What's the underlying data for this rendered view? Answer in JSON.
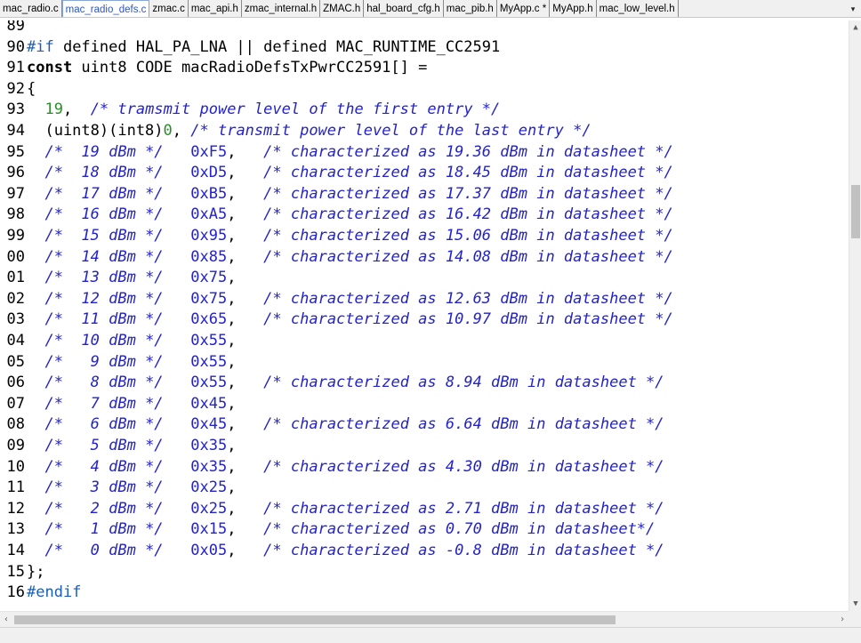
{
  "tabs": [
    {
      "label": "mac_radio.c",
      "active": false
    },
    {
      "label": "mac_radio_defs.c",
      "active": true
    },
    {
      "label": "zmac.c",
      "active": false
    },
    {
      "label": "mac_api.h",
      "active": false
    },
    {
      "label": "zmac_internal.h",
      "active": false
    },
    {
      "label": "ZMAC.h",
      "active": false
    },
    {
      "label": "hal_board_cfg.h",
      "active": false
    },
    {
      "label": "mac_pib.h",
      "active": false
    },
    {
      "label": "MyApp.c *",
      "active": false
    },
    {
      "label": "MyApp.h",
      "active": false
    },
    {
      "label": "mac_low_level.h",
      "active": false
    }
  ],
  "tab_overflow_icon": "chevron-down-icon",
  "colors": {
    "preprocessor": "#1a5fb4",
    "comment": "#2323c8",
    "number": "#2e8b2e",
    "active_tab_text": "#2b56c6"
  },
  "editor": {
    "lines": [
      {
        "num": "89",
        "tokens": []
      },
      {
        "num": "90",
        "tokens": [
          {
            "t": "pp",
            "v": "#if"
          },
          {
            "t": "plain",
            "v": " defined HAL_PA_LNA || defined MAC_RUNTIME_CC2591"
          }
        ]
      },
      {
        "num": "91",
        "tokens": [
          {
            "t": "kw",
            "v": "const"
          },
          {
            "t": "plain",
            "v": " uint8 CODE macRadioDefsTxPwrCC2591[] ="
          }
        ]
      },
      {
        "num": "92",
        "tokens": [
          {
            "t": "punc",
            "v": "{"
          }
        ]
      },
      {
        "num": "93",
        "tokens": [
          {
            "t": "plain",
            "v": "  "
          },
          {
            "t": "num",
            "v": "19"
          },
          {
            "t": "plain",
            "v": ",  "
          },
          {
            "t": "cm",
            "v": "/* tramsmit power level of the first entry */"
          }
        ]
      },
      {
        "num": "94",
        "tokens": [
          {
            "t": "plain",
            "v": "  (uint8)(int8)"
          },
          {
            "t": "num",
            "v": "0"
          },
          {
            "t": "plain",
            "v": ", "
          },
          {
            "t": "cm",
            "v": "/* transmit power level of the last entry */"
          }
        ]
      },
      {
        "num": "95",
        "tokens": [
          {
            "t": "plain",
            "v": "  "
          },
          {
            "t": "cm",
            "v": "/*  19 dBm */"
          },
          {
            "t": "plain",
            "v": "   "
          },
          {
            "t": "hex",
            "v": "0xF5"
          },
          {
            "t": "plain",
            "v": ",   "
          },
          {
            "t": "cm",
            "v": "/* characterized as 19.36 dBm in datasheet */"
          }
        ]
      },
      {
        "num": "96",
        "tokens": [
          {
            "t": "plain",
            "v": "  "
          },
          {
            "t": "cm",
            "v": "/*  18 dBm */"
          },
          {
            "t": "plain",
            "v": "   "
          },
          {
            "t": "hex",
            "v": "0xD5"
          },
          {
            "t": "plain",
            "v": ",   "
          },
          {
            "t": "cm",
            "v": "/* characterized as 18.45 dBm in datasheet */"
          }
        ]
      },
      {
        "num": "97",
        "tokens": [
          {
            "t": "plain",
            "v": "  "
          },
          {
            "t": "cm",
            "v": "/*  17 dBm */"
          },
          {
            "t": "plain",
            "v": "   "
          },
          {
            "t": "hex",
            "v": "0xB5"
          },
          {
            "t": "plain",
            "v": ",   "
          },
          {
            "t": "cm",
            "v": "/* characterized as 17.37 dBm in datasheet */"
          }
        ]
      },
      {
        "num": "98",
        "tokens": [
          {
            "t": "plain",
            "v": "  "
          },
          {
            "t": "cm",
            "v": "/*  16 dBm */"
          },
          {
            "t": "plain",
            "v": "   "
          },
          {
            "t": "hex",
            "v": "0xA5"
          },
          {
            "t": "plain",
            "v": ",   "
          },
          {
            "t": "cm",
            "v": "/* characterized as 16.42 dBm in datasheet */"
          }
        ]
      },
      {
        "num": "99",
        "tokens": [
          {
            "t": "plain",
            "v": "  "
          },
          {
            "t": "cm",
            "v": "/*  15 dBm */"
          },
          {
            "t": "plain",
            "v": "   "
          },
          {
            "t": "hex",
            "v": "0x95"
          },
          {
            "t": "plain",
            "v": ",   "
          },
          {
            "t": "cm",
            "v": "/* characterized as 15.06 dBm in datasheet */"
          }
        ]
      },
      {
        "num": "00",
        "tokens": [
          {
            "t": "plain",
            "v": "  "
          },
          {
            "t": "cm",
            "v": "/*  14 dBm */"
          },
          {
            "t": "plain",
            "v": "   "
          },
          {
            "t": "hex",
            "v": "0x85"
          },
          {
            "t": "plain",
            "v": ",   "
          },
          {
            "t": "cm",
            "v": "/* characterized as 14.08 dBm in datasheet */"
          }
        ]
      },
      {
        "num": "01",
        "tokens": [
          {
            "t": "plain",
            "v": "  "
          },
          {
            "t": "cm",
            "v": "/*  13 dBm */"
          },
          {
            "t": "plain",
            "v": "   "
          },
          {
            "t": "hex",
            "v": "0x75"
          },
          {
            "t": "plain",
            "v": ","
          }
        ]
      },
      {
        "num": "02",
        "tokens": [
          {
            "t": "plain",
            "v": "  "
          },
          {
            "t": "cm",
            "v": "/*  12 dBm */"
          },
          {
            "t": "plain",
            "v": "   "
          },
          {
            "t": "hex",
            "v": "0x75"
          },
          {
            "t": "plain",
            "v": ",   "
          },
          {
            "t": "cm",
            "v": "/* characterized as 12.63 dBm in datasheet */"
          }
        ]
      },
      {
        "num": "03",
        "tokens": [
          {
            "t": "plain",
            "v": "  "
          },
          {
            "t": "cm",
            "v": "/*  11 dBm */"
          },
          {
            "t": "plain",
            "v": "   "
          },
          {
            "t": "hex",
            "v": "0x65"
          },
          {
            "t": "plain",
            "v": ",   "
          },
          {
            "t": "cm",
            "v": "/* characterized as 10.97 dBm in datasheet */"
          }
        ]
      },
      {
        "num": "04",
        "tokens": [
          {
            "t": "plain",
            "v": "  "
          },
          {
            "t": "cm",
            "v": "/*  10 dBm */"
          },
          {
            "t": "plain",
            "v": "   "
          },
          {
            "t": "hex",
            "v": "0x55"
          },
          {
            "t": "plain",
            "v": ","
          }
        ]
      },
      {
        "num": "05",
        "tokens": [
          {
            "t": "plain",
            "v": "  "
          },
          {
            "t": "cm",
            "v": "/*   9 dBm */"
          },
          {
            "t": "plain",
            "v": "   "
          },
          {
            "t": "hex",
            "v": "0x55"
          },
          {
            "t": "plain",
            "v": ","
          }
        ]
      },
      {
        "num": "06",
        "tokens": [
          {
            "t": "plain",
            "v": "  "
          },
          {
            "t": "cm",
            "v": "/*   8 dBm */"
          },
          {
            "t": "plain",
            "v": "   "
          },
          {
            "t": "hex",
            "v": "0x55"
          },
          {
            "t": "plain",
            "v": ",   "
          },
          {
            "t": "cm",
            "v": "/* characterized as 8.94 dBm in datasheet */"
          }
        ]
      },
      {
        "num": "07",
        "tokens": [
          {
            "t": "plain",
            "v": "  "
          },
          {
            "t": "cm",
            "v": "/*   7 dBm */"
          },
          {
            "t": "plain",
            "v": "   "
          },
          {
            "t": "hex",
            "v": "0x45"
          },
          {
            "t": "plain",
            "v": ","
          }
        ]
      },
      {
        "num": "08",
        "tokens": [
          {
            "t": "plain",
            "v": "  "
          },
          {
            "t": "cm",
            "v": "/*   6 dBm */"
          },
          {
            "t": "plain",
            "v": "   "
          },
          {
            "t": "hex",
            "v": "0x45"
          },
          {
            "t": "plain",
            "v": ",   "
          },
          {
            "t": "cm",
            "v": "/* characterized as 6.64 dBm in datasheet */"
          }
        ]
      },
      {
        "num": "09",
        "tokens": [
          {
            "t": "plain",
            "v": "  "
          },
          {
            "t": "cm",
            "v": "/*   5 dBm */"
          },
          {
            "t": "plain",
            "v": "   "
          },
          {
            "t": "hex",
            "v": "0x35"
          },
          {
            "t": "plain",
            "v": ","
          }
        ]
      },
      {
        "num": "10",
        "tokens": [
          {
            "t": "plain",
            "v": "  "
          },
          {
            "t": "cm",
            "v": "/*   4 dBm */"
          },
          {
            "t": "plain",
            "v": "   "
          },
          {
            "t": "hex",
            "v": "0x35"
          },
          {
            "t": "plain",
            "v": ",   "
          },
          {
            "t": "cm",
            "v": "/* characterized as 4.30 dBm in datasheet */"
          }
        ]
      },
      {
        "num": "11",
        "tokens": [
          {
            "t": "plain",
            "v": "  "
          },
          {
            "t": "cm",
            "v": "/*   3 dBm */"
          },
          {
            "t": "plain",
            "v": "   "
          },
          {
            "t": "hex",
            "v": "0x25"
          },
          {
            "t": "plain",
            "v": ","
          }
        ]
      },
      {
        "num": "12",
        "tokens": [
          {
            "t": "plain",
            "v": "  "
          },
          {
            "t": "cm",
            "v": "/*   2 dBm */"
          },
          {
            "t": "plain",
            "v": "   "
          },
          {
            "t": "hex",
            "v": "0x25"
          },
          {
            "t": "plain",
            "v": ",   "
          },
          {
            "t": "cm",
            "v": "/* characterized as 2.71 dBm in datasheet */"
          }
        ]
      },
      {
        "num": "13",
        "tokens": [
          {
            "t": "plain",
            "v": "  "
          },
          {
            "t": "cm",
            "v": "/*   1 dBm */"
          },
          {
            "t": "plain",
            "v": "   "
          },
          {
            "t": "hex",
            "v": "0x15"
          },
          {
            "t": "plain",
            "v": ",   "
          },
          {
            "t": "cm",
            "v": "/* characterized as 0.70 dBm in datasheet*/"
          }
        ]
      },
      {
        "num": "14",
        "tokens": [
          {
            "t": "plain",
            "v": "  "
          },
          {
            "t": "cm",
            "v": "/*   0 dBm */"
          },
          {
            "t": "plain",
            "v": "   "
          },
          {
            "t": "hex",
            "v": "0x05"
          },
          {
            "t": "plain",
            "v": ",   "
          },
          {
            "t": "cm",
            "v": "/* characterized as -0.8 dBm in datasheet */"
          }
        ]
      },
      {
        "num": "15",
        "tokens": [
          {
            "t": "punc",
            "v": "};"
          }
        ]
      },
      {
        "num": "16",
        "tokens": [
          {
            "t": "pp",
            "v": "#endif"
          }
        ]
      }
    ]
  },
  "scrollbars": {
    "vertical": {
      "up_icon": "chevron-up-icon",
      "down_icon": "chevron-down-icon"
    },
    "horizontal": {
      "left_icon": "chevron-left-icon",
      "right_icon": "chevron-right-icon"
    }
  }
}
